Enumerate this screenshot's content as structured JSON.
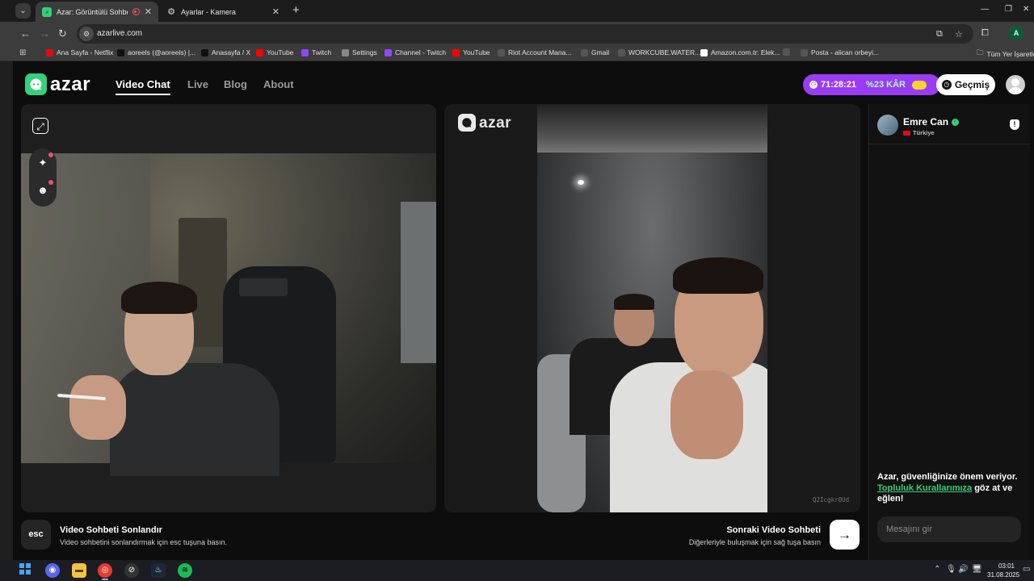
{
  "browser": {
    "tabs": [
      {
        "title": "Azar: Görüntülü Sohbet, Arı",
        "active": true
      },
      {
        "title": "Ayarlar - Kamera",
        "active": false
      }
    ],
    "url": "azarlive.com",
    "profile_initial": "A",
    "bookmarks": [
      {
        "label": "Ana Sayfa - Netflix",
        "icon": "netflix-icon",
        "color": "#e50914"
      },
      {
        "label": "aoreels (@aoreels) |...",
        "icon": "tiktok-icon",
        "color": "#111111"
      },
      {
        "label": "Anasayfa / X",
        "icon": "x-icon",
        "color": "#111111"
      },
      {
        "label": "YouTube",
        "icon": "youtube-icon",
        "color": "#ff0000"
      },
      {
        "label": "Twitch",
        "icon": "twitch-icon",
        "color": "#9146ff"
      },
      {
        "label": "Settings",
        "icon": "apple-icon",
        "color": "#888888"
      },
      {
        "label": "Channel - Twitch",
        "icon": "twitch-icon",
        "color": "#9146ff"
      },
      {
        "label": "YouTube",
        "icon": "youtube-icon",
        "color": "#ff0000"
      },
      {
        "label": "Riot Account Mana...",
        "icon": "globe-icon",
        "color": "#555555"
      },
      {
        "label": "Gmail",
        "icon": "globe-icon",
        "color": "#555555"
      },
      {
        "label": "WORKCUBE.WATER...",
        "icon": "globe-icon",
        "color": "#555555"
      },
      {
        "label": "Amazon.com.tr: Elek...",
        "icon": "amazon-icon",
        "color": "#ffffff"
      },
      {
        "label": "",
        "icon": "globe-icon",
        "color": "#555555"
      },
      {
        "label": "Posta - alican orbeyi...",
        "icon": "globe-icon",
        "color": "#555555"
      }
    ],
    "all_bookmarks": "Tüm Yer İşaretle"
  },
  "site": {
    "brand": "azar",
    "nav": [
      "Video Chat",
      "Live",
      "Blog",
      "About"
    ],
    "timer": "71:28:21",
    "discount": "%23 KÂR",
    "history": "Geçmiş"
  },
  "video": {
    "watermark": "azar",
    "session_code": "Q2Icgkr0Ud"
  },
  "chat": {
    "peer_name": "Emre Can",
    "peer_country": "Türkiye",
    "notice_prefix": "Azar, güvenliğinize önem veriyor. ",
    "notice_link": "Topluluk Kurallarımıza",
    "notice_suffix": " göz at ve eğlen!",
    "input_placeholder": "Mesajını gir"
  },
  "controls": {
    "esc_key": "esc",
    "end_title": "Video Sohbeti Sonlandır",
    "end_desc": "Video sohbetini sonlandırmak için esc tuşuna basın.",
    "next_title": "Sonraki Video Sohbeti",
    "next_desc": "Diğerleriyle buluşmak için sağ tuşa basın"
  },
  "taskbar": {
    "time": "03:01",
    "date": "31.08.2025"
  },
  "colors": {
    "brand_green": "#33d17a",
    "timer_purple": "#9b3cf5"
  }
}
